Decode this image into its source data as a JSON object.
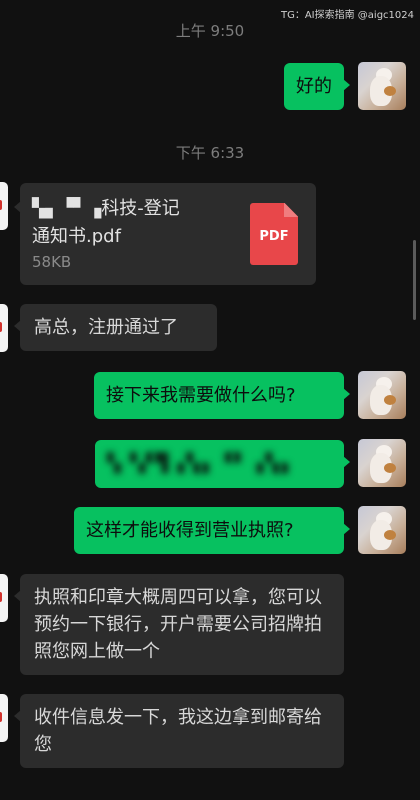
{
  "watermark": "TG：AI探索指南 @aigc1024",
  "timestamps": [
    "上午 9:50",
    "下午 6:33"
  ],
  "messages": {
    "m1": "好的",
    "file_title_line1": "▚▖▝▘▗科技-登记",
    "file_title_line2": "通知书.pdf",
    "file_size": "58KB",
    "file_type": "PDF",
    "m2": "高总，注册通过了",
    "m3": "接下来我需要做什么吗?",
    "m4_blurred": "▚▝▞▜▗▚▖▝▘▗▚▖",
    "m5": "这样才能收得到营业执照?",
    "m6": "执照和印章大概周四可以拿，您可以预约一下银行，开户需要公司招牌拍照您网上做一个",
    "m7": "收件信息发一下，我这边拿到邮寄给您"
  },
  "colors": {
    "background": "#111111",
    "my_bubble": "#07c160",
    "other_bubble": "#2c2c2c",
    "pdf_icon": "#e8474a"
  },
  "icons": {
    "my_avatar": "cat-avatar-icon",
    "other_avatar": "contact-avatar-icon",
    "file": "pdf-file-icon"
  }
}
